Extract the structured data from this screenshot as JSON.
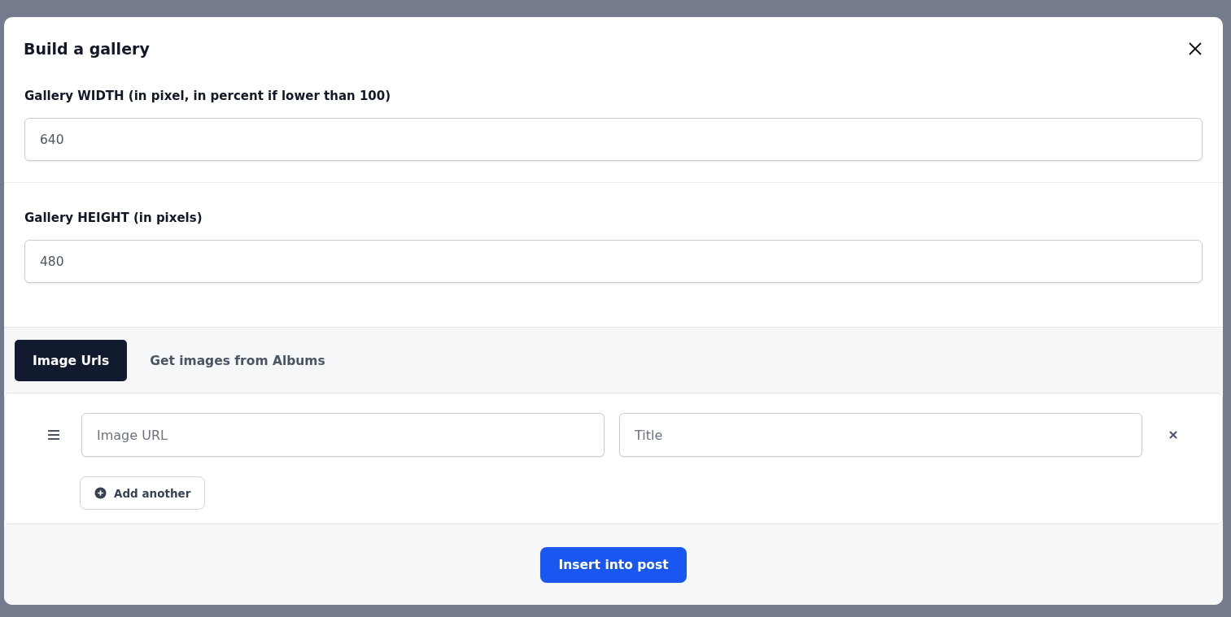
{
  "dialog": {
    "title": "Build a gallery",
    "fields": [
      {
        "label": "Gallery WIDTH (in pixel, in percent if lower than 100)",
        "value": "640"
      },
      {
        "label": "Gallery HEIGHT (in pixels)",
        "value": "480"
      }
    ],
    "tabs": [
      {
        "label": "Image Urls",
        "selected": true
      },
      {
        "label": "Get images from Albums",
        "selected": false
      }
    ],
    "image_rows": [
      {
        "url": {
          "placeholder": "Image URL"
        },
        "title": {
          "placeholder": "Title"
        }
      }
    ],
    "add_button": "Add another",
    "submit_button": "Insert into post"
  }
}
